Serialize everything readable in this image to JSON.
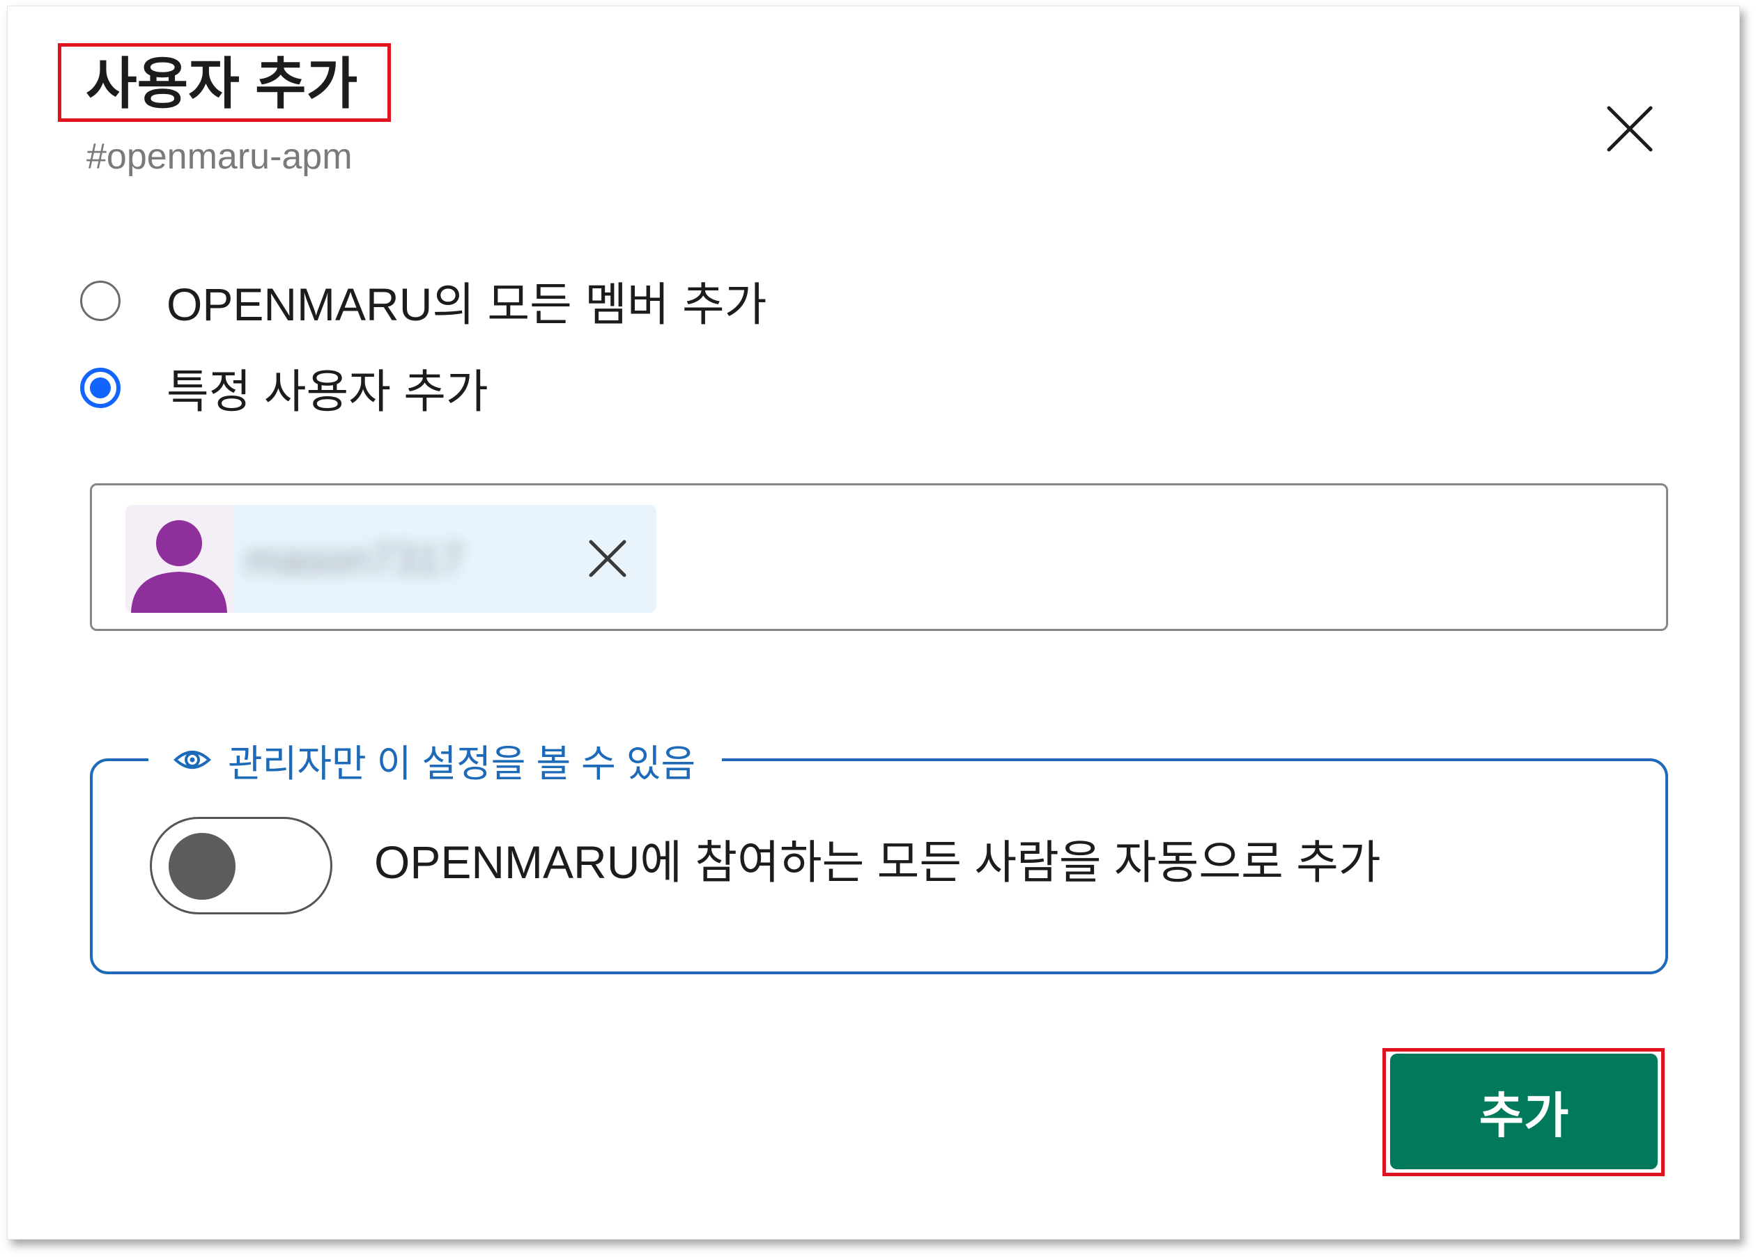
{
  "dialog": {
    "title": "사용자 추가",
    "subtitle": "#openmaru-apm"
  },
  "options": [
    {
      "label": "OPENMARU의 모든 멤버 추가",
      "selected": false
    },
    {
      "label": "특정 사용자 추가",
      "selected": true
    }
  ],
  "selected_user": {
    "name": "mason7317",
    "avatar_color": "#8e2f9c"
  },
  "admin_section": {
    "legend": "관리자만 이 설정을 볼 수 있음",
    "toggle_label": "OPENMARU에 참여하는 모든 사람을 자동으로 추가",
    "toggle_on": false,
    "accent": "#1d6ab8"
  },
  "footer": {
    "add_label": "추가",
    "add_color": "#007a5a"
  },
  "highlight_color": "#e0141e"
}
